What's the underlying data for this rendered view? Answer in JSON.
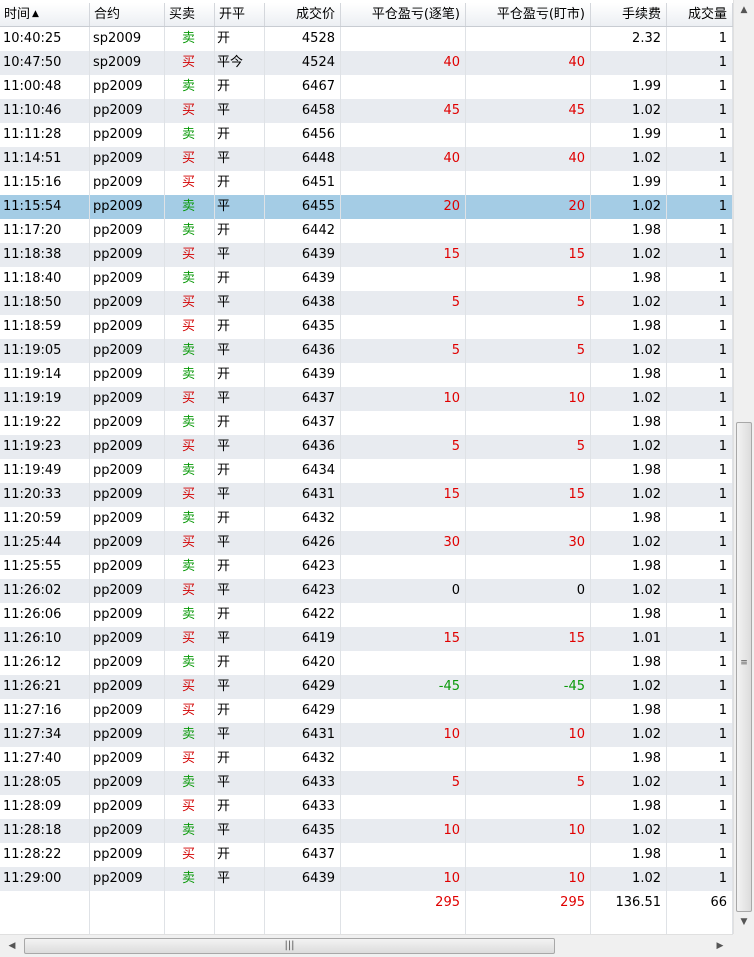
{
  "table": {
    "columns": [
      {
        "key": "time",
        "label": "时间",
        "sorted": "asc"
      },
      {
        "key": "contract",
        "label": "合约"
      },
      {
        "key": "direction",
        "label": "买卖"
      },
      {
        "key": "open_close",
        "label": "开平"
      },
      {
        "key": "price",
        "label": "成交价"
      },
      {
        "key": "pnl_trade",
        "label": "平仓盈亏(逐笔)"
      },
      {
        "key": "pnl_mark",
        "label": "平仓盈亏(盯市)"
      },
      {
        "key": "fee",
        "label": "手续费"
      },
      {
        "key": "volume",
        "label": "成交量"
      }
    ],
    "selected_row_index": 7,
    "rows": [
      {
        "time": "10:40:25",
        "contract": "sp2009",
        "direction": "卖",
        "open_close": "开",
        "price": "4528",
        "pnl_trade": "",
        "pnl_mark": "",
        "fee": "2.32",
        "volume": "1"
      },
      {
        "time": "10:47:50",
        "contract": "sp2009",
        "direction": "买",
        "open_close": "平今",
        "price": "4524",
        "pnl_trade": "40",
        "pnl_mark": "40",
        "fee": "",
        "volume": "1"
      },
      {
        "time": "11:00:48",
        "contract": "pp2009",
        "direction": "卖",
        "open_close": "开",
        "price": "6467",
        "pnl_trade": "",
        "pnl_mark": "",
        "fee": "1.99",
        "volume": "1"
      },
      {
        "time": "11:10:46",
        "contract": "pp2009",
        "direction": "买",
        "open_close": "平",
        "price": "6458",
        "pnl_trade": "45",
        "pnl_mark": "45",
        "fee": "1.02",
        "volume": "1"
      },
      {
        "time": "11:11:28",
        "contract": "pp2009",
        "direction": "卖",
        "open_close": "开",
        "price": "6456",
        "pnl_trade": "",
        "pnl_mark": "",
        "fee": "1.99",
        "volume": "1"
      },
      {
        "time": "11:14:51",
        "contract": "pp2009",
        "direction": "买",
        "open_close": "平",
        "price": "6448",
        "pnl_trade": "40",
        "pnl_mark": "40",
        "fee": "1.02",
        "volume": "1"
      },
      {
        "time": "11:15:16",
        "contract": "pp2009",
        "direction": "买",
        "open_close": "开",
        "price": "6451",
        "pnl_trade": "",
        "pnl_mark": "",
        "fee": "1.99",
        "volume": "1"
      },
      {
        "time": "11:15:54",
        "contract": "pp2009",
        "direction": "卖",
        "open_close": "平",
        "price": "6455",
        "pnl_trade": "20",
        "pnl_mark": "20",
        "fee": "1.02",
        "volume": "1"
      },
      {
        "time": "11:17:20",
        "contract": "pp2009",
        "direction": "卖",
        "open_close": "开",
        "price": "6442",
        "pnl_trade": "",
        "pnl_mark": "",
        "fee": "1.98",
        "volume": "1"
      },
      {
        "time": "11:18:38",
        "contract": "pp2009",
        "direction": "买",
        "open_close": "平",
        "price": "6439",
        "pnl_trade": "15",
        "pnl_mark": "15",
        "fee": "1.02",
        "volume": "1"
      },
      {
        "time": "11:18:40",
        "contract": "pp2009",
        "direction": "卖",
        "open_close": "开",
        "price": "6439",
        "pnl_trade": "",
        "pnl_mark": "",
        "fee": "1.98",
        "volume": "1"
      },
      {
        "time": "11:18:50",
        "contract": "pp2009",
        "direction": "买",
        "open_close": "平",
        "price": "6438",
        "pnl_trade": "5",
        "pnl_mark": "5",
        "fee": "1.02",
        "volume": "1"
      },
      {
        "time": "11:18:59",
        "contract": "pp2009",
        "direction": "买",
        "open_close": "开",
        "price": "6435",
        "pnl_trade": "",
        "pnl_mark": "",
        "fee": "1.98",
        "volume": "1"
      },
      {
        "time": "11:19:05",
        "contract": "pp2009",
        "direction": "卖",
        "open_close": "平",
        "price": "6436",
        "pnl_trade": "5",
        "pnl_mark": "5",
        "fee": "1.02",
        "volume": "1"
      },
      {
        "time": "11:19:14",
        "contract": "pp2009",
        "direction": "卖",
        "open_close": "开",
        "price": "6439",
        "pnl_trade": "",
        "pnl_mark": "",
        "fee": "1.98",
        "volume": "1"
      },
      {
        "time": "11:19:19",
        "contract": "pp2009",
        "direction": "买",
        "open_close": "平",
        "price": "6437",
        "pnl_trade": "10",
        "pnl_mark": "10",
        "fee": "1.02",
        "volume": "1"
      },
      {
        "time": "11:19:22",
        "contract": "pp2009",
        "direction": "卖",
        "open_close": "开",
        "price": "6437",
        "pnl_trade": "",
        "pnl_mark": "",
        "fee": "1.98",
        "volume": "1"
      },
      {
        "time": "11:19:23",
        "contract": "pp2009",
        "direction": "买",
        "open_close": "平",
        "price": "6436",
        "pnl_trade": "5",
        "pnl_mark": "5",
        "fee": "1.02",
        "volume": "1"
      },
      {
        "time": "11:19:49",
        "contract": "pp2009",
        "direction": "卖",
        "open_close": "开",
        "price": "6434",
        "pnl_trade": "",
        "pnl_mark": "",
        "fee": "1.98",
        "volume": "1"
      },
      {
        "time": "11:20:33",
        "contract": "pp2009",
        "direction": "买",
        "open_close": "平",
        "price": "6431",
        "pnl_trade": "15",
        "pnl_mark": "15",
        "fee": "1.02",
        "volume": "1"
      },
      {
        "time": "11:20:59",
        "contract": "pp2009",
        "direction": "卖",
        "open_close": "开",
        "price": "6432",
        "pnl_trade": "",
        "pnl_mark": "",
        "fee": "1.98",
        "volume": "1"
      },
      {
        "time": "11:25:44",
        "contract": "pp2009",
        "direction": "买",
        "open_close": "平",
        "price": "6426",
        "pnl_trade": "30",
        "pnl_mark": "30",
        "fee": "1.02",
        "volume": "1"
      },
      {
        "time": "11:25:55",
        "contract": "pp2009",
        "direction": "卖",
        "open_close": "开",
        "price": "6423",
        "pnl_trade": "",
        "pnl_mark": "",
        "fee": "1.98",
        "volume": "1"
      },
      {
        "time": "11:26:02",
        "contract": "pp2009",
        "direction": "买",
        "open_close": "平",
        "price": "6423",
        "pnl_trade": "0",
        "pnl_mark": "0",
        "fee": "1.02",
        "volume": "1"
      },
      {
        "time": "11:26:06",
        "contract": "pp2009",
        "direction": "卖",
        "open_close": "开",
        "price": "6422",
        "pnl_trade": "",
        "pnl_mark": "",
        "fee": "1.98",
        "volume": "1"
      },
      {
        "time": "11:26:10",
        "contract": "pp2009",
        "direction": "买",
        "open_close": "平",
        "price": "6419",
        "pnl_trade": "15",
        "pnl_mark": "15",
        "fee": "1.01",
        "volume": "1"
      },
      {
        "time": "11:26:12",
        "contract": "pp2009",
        "direction": "卖",
        "open_close": "开",
        "price": "6420",
        "pnl_trade": "",
        "pnl_mark": "",
        "fee": "1.98",
        "volume": "1"
      },
      {
        "time": "11:26:21",
        "contract": "pp2009",
        "direction": "买",
        "open_close": "平",
        "price": "6429",
        "pnl_trade": "-45",
        "pnl_mark": "-45",
        "fee": "1.02",
        "volume": "1"
      },
      {
        "time": "11:27:16",
        "contract": "pp2009",
        "direction": "买",
        "open_close": "开",
        "price": "6429",
        "pnl_trade": "",
        "pnl_mark": "",
        "fee": "1.98",
        "volume": "1"
      },
      {
        "time": "11:27:34",
        "contract": "pp2009",
        "direction": "卖",
        "open_close": "平",
        "price": "6431",
        "pnl_trade": "10",
        "pnl_mark": "10",
        "fee": "1.02",
        "volume": "1"
      },
      {
        "time": "11:27:40",
        "contract": "pp2009",
        "direction": "买",
        "open_close": "开",
        "price": "6432",
        "pnl_trade": "",
        "pnl_mark": "",
        "fee": "1.98",
        "volume": "1"
      },
      {
        "time": "11:28:05",
        "contract": "pp2009",
        "direction": "卖",
        "open_close": "平",
        "price": "6433",
        "pnl_trade": "5",
        "pnl_mark": "5",
        "fee": "1.02",
        "volume": "1"
      },
      {
        "time": "11:28:09",
        "contract": "pp2009",
        "direction": "买",
        "open_close": "开",
        "price": "6433",
        "pnl_trade": "",
        "pnl_mark": "",
        "fee": "1.98",
        "volume": "1"
      },
      {
        "time": "11:28:18",
        "contract": "pp2009",
        "direction": "卖",
        "open_close": "平",
        "price": "6435",
        "pnl_trade": "10",
        "pnl_mark": "10",
        "fee": "1.02",
        "volume": "1"
      },
      {
        "time": "11:28:22",
        "contract": "pp2009",
        "direction": "买",
        "open_close": "开",
        "price": "6437",
        "pnl_trade": "",
        "pnl_mark": "",
        "fee": "1.98",
        "volume": "1"
      },
      {
        "time": "11:29:00",
        "contract": "pp2009",
        "direction": "卖",
        "open_close": "平",
        "price": "6439",
        "pnl_trade": "10",
        "pnl_mark": "10",
        "fee": "1.02",
        "volume": "1"
      }
    ],
    "totals": {
      "pnl_trade": "295",
      "pnl_mark": "295",
      "fee": "136.51",
      "volume": "66"
    }
  },
  "colors": {
    "buy": "#d20000",
    "sell": "#0a9a0a",
    "profit": "#e00000",
    "loss": "#0a9a0a",
    "selected_row": "#a4cce5",
    "alt_row": "#e8ebf0"
  },
  "icons": {
    "sort": "sort-ascending-icon",
    "scroll_up": "arrow-up-icon",
    "scroll_down": "arrow-down-icon",
    "scroll_left": "arrow-left-icon",
    "scroll_right": "arrow-right-icon"
  }
}
